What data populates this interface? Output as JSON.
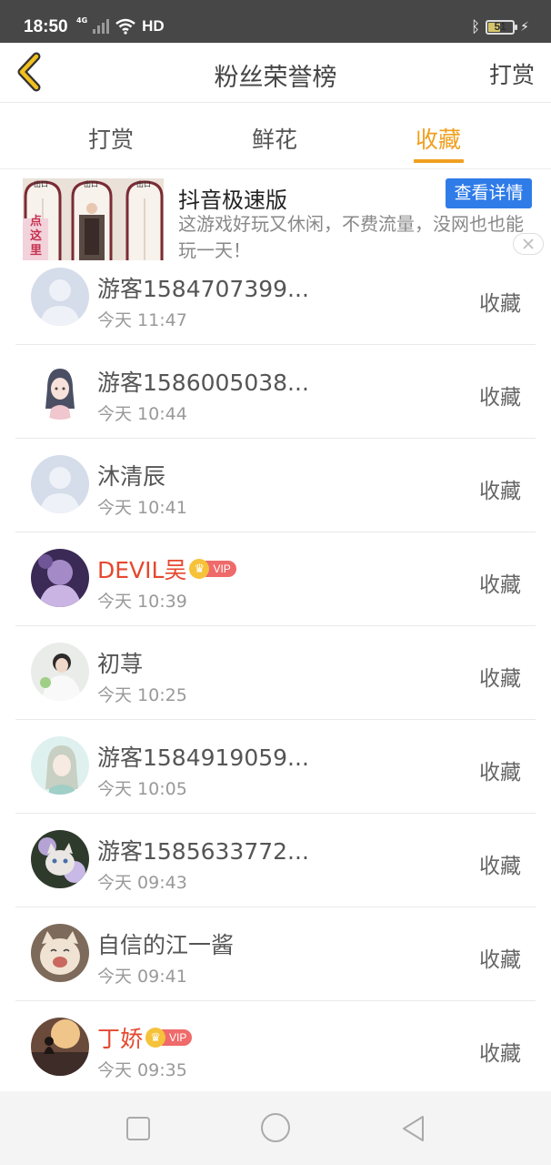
{
  "status_bar": {
    "time": "18:50",
    "network": "4G",
    "hd": "HD",
    "battery": "51",
    "battery_level": 0.51
  },
  "header": {
    "title": "粉丝荣誉榜",
    "action": "打赏"
  },
  "tabs": [
    {
      "label": "打赏",
      "active": false
    },
    {
      "label": "鲜花",
      "active": false
    },
    {
      "label": "收藏",
      "active": true
    }
  ],
  "ad": {
    "title": "抖音极速版",
    "description": "这游戏好玩又休闲，不费流量，没网也也能玩一天！",
    "button": "查看详情",
    "image_sign_1": "出口",
    "image_sign_2": "出口",
    "image_sign_3": "出口",
    "image_text": "点这里"
  },
  "list": [
    {
      "name": "游客1584707399...",
      "time": "今天 11:47",
      "action": "收藏",
      "vip": false,
      "avatar": "default-avatar"
    },
    {
      "name": "游客1586005038...",
      "time": "今天 10:44",
      "action": "收藏",
      "vip": false,
      "avatar": "anime-girl-avatar"
    },
    {
      "name": "沐清辰",
      "time": "今天 10:41",
      "action": "收藏",
      "vip": false,
      "avatar": "default-avatar"
    },
    {
      "name": "DEVIL吴",
      "time": "今天 10:39",
      "action": "收藏",
      "vip": true,
      "vip_label": "VIP",
      "avatar": "purple-photo-avatar"
    },
    {
      "name": "初荨",
      "time": "今天 10:25",
      "action": "收藏",
      "vip": false,
      "avatar": "person-photo-avatar"
    },
    {
      "name": "游客1584919059...",
      "time": "今天 10:05",
      "action": "收藏",
      "vip": false,
      "avatar": "anime-teal-avatar"
    },
    {
      "name": "游客1585633772...",
      "time": "今天 09:43",
      "action": "收藏",
      "vip": false,
      "avatar": "cat-photo-avatar"
    },
    {
      "name": "自信的江一酱",
      "time": "今天 09:41",
      "action": "收藏",
      "vip": false,
      "avatar": "kitten-photo-avatar"
    },
    {
      "name": "丁娇",
      "time": "今天 09:35",
      "action": "收藏",
      "vip": true,
      "vip_label": "VIP",
      "avatar": "sunset-photo-avatar"
    }
  ],
  "colors": {
    "accent": "#f0a020",
    "vip_name": "#e5482f",
    "ad_button": "#2f7ce8",
    "status_bar": "#474747"
  }
}
